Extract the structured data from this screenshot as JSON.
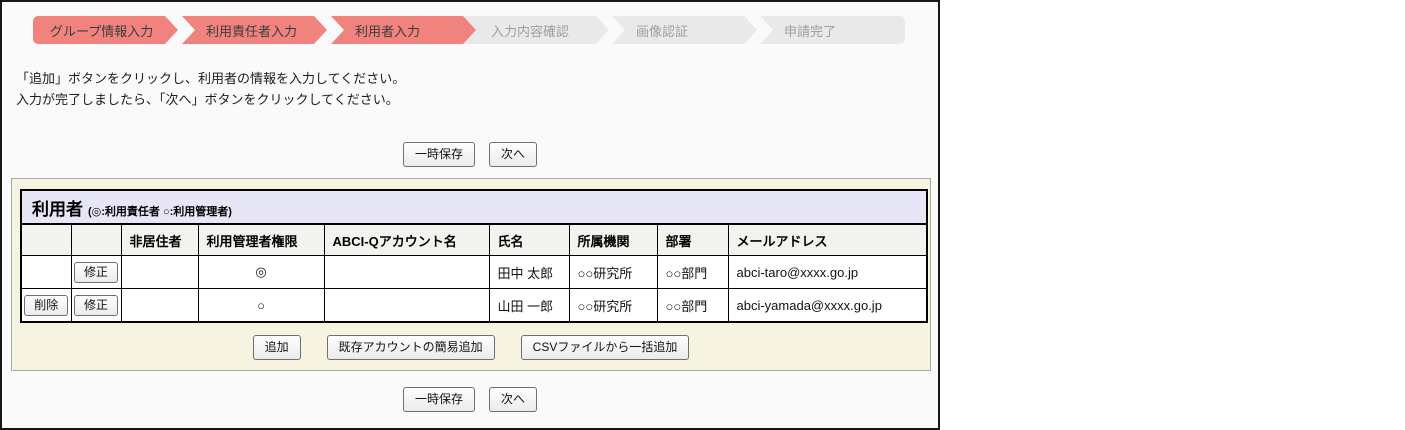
{
  "stepper": {
    "steps": [
      {
        "label": "グループ情報入力",
        "state": "active"
      },
      {
        "label": "利用責任者入力",
        "state": "active"
      },
      {
        "label": "利用者入力",
        "state": "active"
      },
      {
        "label": "入力内容確認",
        "state": "inactive"
      },
      {
        "label": "画像認証",
        "state": "inactive"
      },
      {
        "label": "申請完了",
        "state": "inactive"
      }
    ]
  },
  "instructions": {
    "line1": "「追加」ボタンをクリックし、利用者の情報を入力してください。",
    "line2": "入力が完了しましたら、「次へ」ボタンをクリックしてください。"
  },
  "actions": {
    "save_label": "一時保存",
    "next_label": "次へ"
  },
  "panel": {
    "title": "利用者",
    "legend": "(◎:利用責任者 ○:利用管理者)",
    "table": {
      "headers": [
        "",
        "",
        "非居住者",
        "利用管理者権限",
        "ABCI-Qアカウント名",
        "氏名",
        "所属機関",
        "部署",
        "メールアドレス"
      ],
      "rows": [
        {
          "delete": "",
          "edit": "修正",
          "non_resident": "",
          "admin_mark": "◎",
          "account": "",
          "name": "田中 太郎",
          "org": "○○研究所",
          "dept": "○○部門",
          "email": "abci-taro@xxxx.go.jp"
        },
        {
          "delete": "削除",
          "edit": "修正",
          "non_resident": "",
          "admin_mark": "○",
          "account": "",
          "name": "山田 一郎",
          "org": "○○研究所",
          "dept": "○○部門",
          "email": "abci-yamada@xxxx.go.jp"
        }
      ]
    },
    "buttons": {
      "add": "追加",
      "add_existing": "既存アカウントの簡易追加",
      "add_csv": "CSVファイルから一括追加"
    }
  },
  "colors": {
    "active_step": "#f0837d",
    "inactive_step": "#e9e9e9",
    "panel_background": "#f6f4e1",
    "table_band_background": "#e6e6f7"
  }
}
